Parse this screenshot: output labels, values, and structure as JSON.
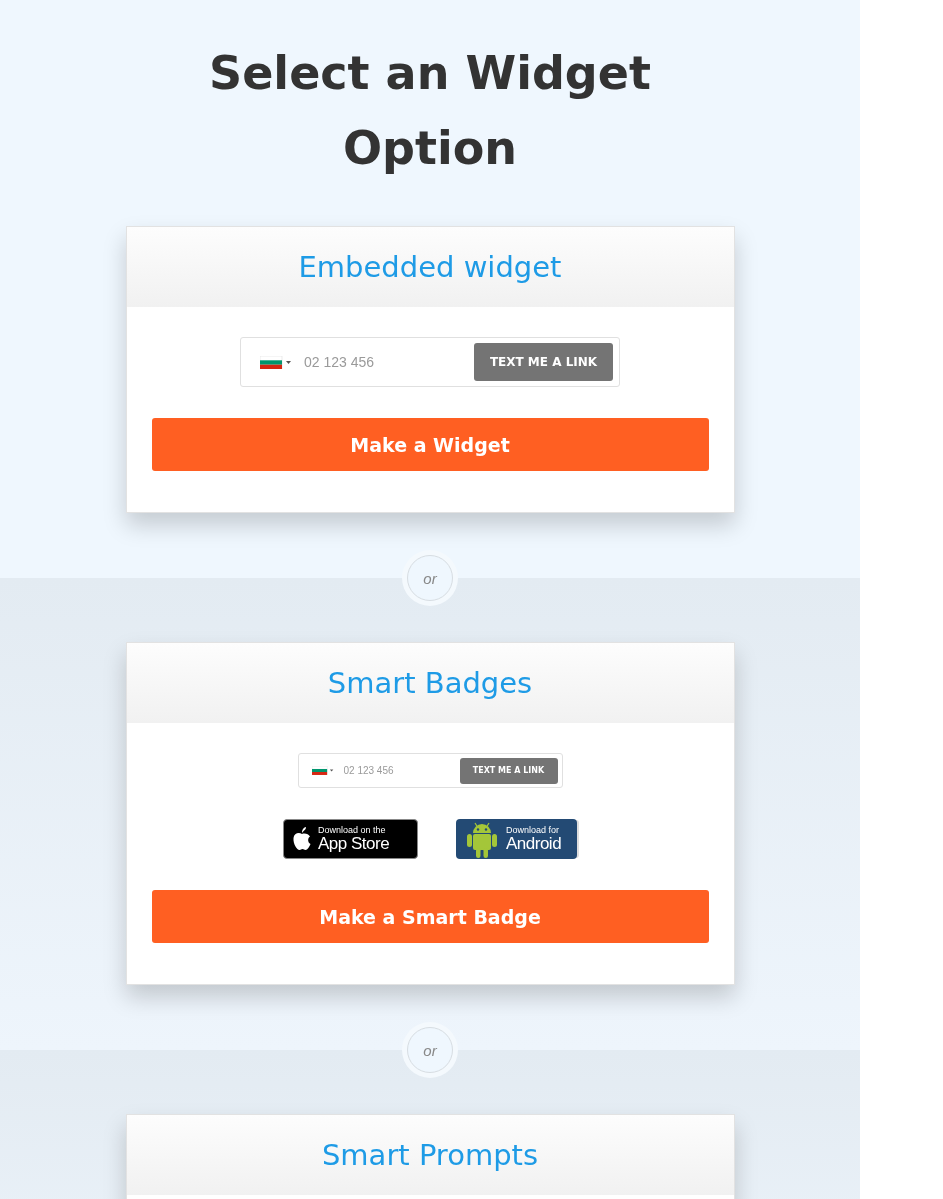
{
  "heading": "Select an Widget Option",
  "options": [
    {
      "title": "Embedded widget",
      "phone_widget": {
        "compact": false,
        "placeholder": "02 123 456",
        "button": "TEXT ME A LINK"
      },
      "button": "Make a Widget"
    },
    {
      "title": "Smart Badges",
      "phone_widget": {
        "compact": true,
        "placeholder": "02 123 456",
        "button": "TEXT ME A LINK"
      },
      "store_badges": [
        {
          "kind": "apple",
          "small": "Download on the",
          "large": "App Store"
        },
        {
          "kind": "android",
          "small": "Download for",
          "large": "Android"
        }
      ],
      "button": "Make a Smart Badge"
    },
    {
      "title": "Smart Prompts"
    }
  ],
  "separators": [
    "or",
    "or"
  ]
}
